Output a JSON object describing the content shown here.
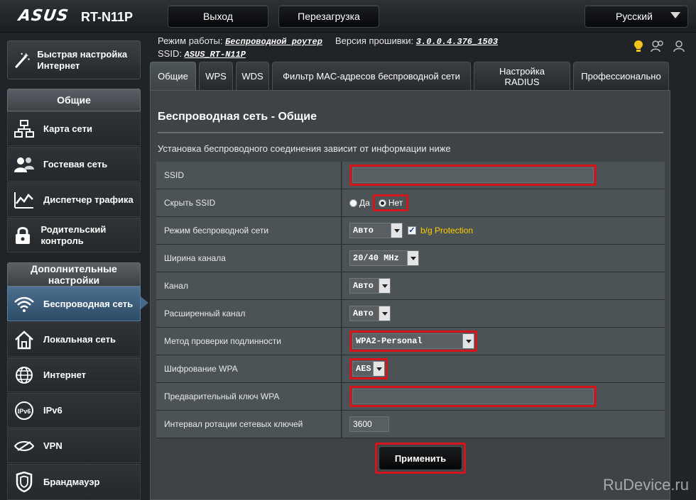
{
  "header": {
    "brand": "ASUS",
    "model": "RT-N11P",
    "logout_label": "Выход",
    "reboot_label": "Перезагрузка",
    "language": "Русский"
  },
  "status": {
    "mode_label": "Режим работы:",
    "mode_value": "Беспроводной роутер",
    "firmware_label": "Версия прошивки:",
    "firmware_value": "3.0.0.4.376_1503",
    "ssid_label": "SSID:",
    "ssid_value": "ASUS_RT-N11P"
  },
  "sidebar": {
    "quick_setup": "Быстрая настройка Интернет",
    "general_header": "Общие",
    "general_items": [
      {
        "label": "Карта сети",
        "icon": "network-map-icon"
      },
      {
        "label": "Гостевая сеть",
        "icon": "guest-network-icon"
      },
      {
        "label": "Диспетчер трафика",
        "icon": "traffic-manager-icon"
      },
      {
        "label": "Родительский контроль",
        "icon": "parental-lock-icon"
      }
    ],
    "advanced_header": "Дополнительные настройки",
    "advanced_items": [
      {
        "label": "Беспроводная сеть",
        "icon": "wifi-icon",
        "active": true
      },
      {
        "label": "Локальная сеть",
        "icon": "home-icon"
      },
      {
        "label": "Интернет",
        "icon": "globe-icon"
      },
      {
        "label": "IPv6",
        "icon": "ipv6-icon"
      },
      {
        "label": "VPN",
        "icon": "vpn-icon"
      },
      {
        "label": "Брандмауэр",
        "icon": "firewall-shield-icon"
      }
    ]
  },
  "tabs": [
    {
      "label": "Общие",
      "active": true
    },
    {
      "label": "WPS"
    },
    {
      "label": "WDS"
    },
    {
      "label": "Фильтр MAC-адресов беспроводной сети"
    },
    {
      "label": "Настройка RADIUS"
    },
    {
      "label": "Профессионально"
    }
  ],
  "main": {
    "title": "Беспроводная сеть - Общие",
    "description": "Установка беспроводного соединения зависит от информации ниже",
    "fields": {
      "ssid": {
        "label": "SSID",
        "value": ""
      },
      "hide_ssid": {
        "label": "Скрыть SSID",
        "yes": "Да",
        "no": "Нет",
        "selected": "no"
      },
      "wireless_mode": {
        "label": "Режим беспроводной сети",
        "value": "Авто",
        "bg_protection": "b/g Protection",
        "bg_checked": true
      },
      "channel_width": {
        "label": "Ширина канала",
        "value": "20/40 MHz"
      },
      "channel": {
        "label": "Канал",
        "value": "Авто"
      },
      "ext_channel": {
        "label": "Расширенный канал",
        "value": "Авто"
      },
      "auth_method": {
        "label": "Метод проверки подлинности",
        "value": "WPA2-Personal"
      },
      "wpa_encryption": {
        "label": "Шифрование WPA",
        "value": "AES"
      },
      "wpa_key": {
        "label": "Предварительный ключ WPA",
        "value": ""
      },
      "key_rotation": {
        "label": "Интервал ротации сетевых ключей",
        "value": "3600"
      }
    },
    "apply_label": "Применить"
  },
  "watermark": "RuDevice.ru",
  "colors": {
    "accent_red": "#d6151b",
    "active_nav": "#46698a",
    "warning_yellow": "#ffcc00"
  }
}
